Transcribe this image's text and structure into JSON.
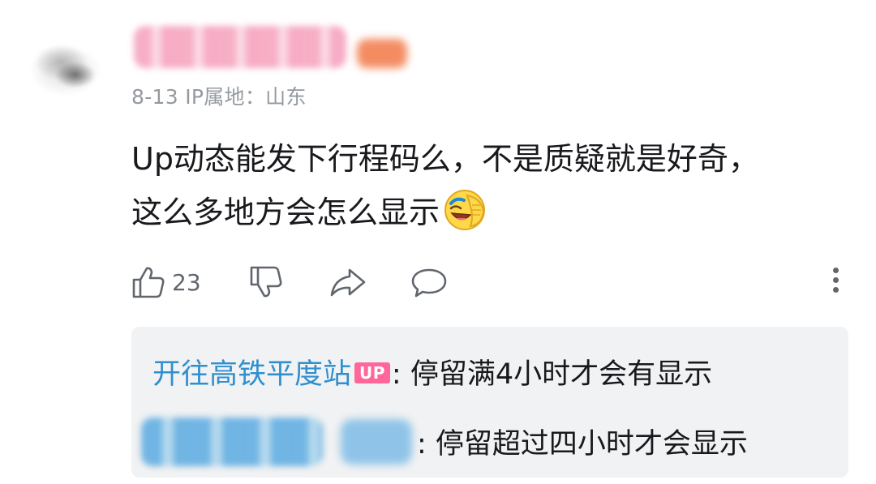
{
  "comment": {
    "date": "8-13",
    "ip_location": "IP属地：山东",
    "text_line1": "Up动态能发下行程码么，不是质疑就是好奇，",
    "text_line2": "这么多地方会怎么显示",
    "emoji_name": "laughing-covering-face-emoji"
  },
  "actions": {
    "like_count": "23",
    "icons": [
      "thumbs-up-icon",
      "thumbs-down-icon",
      "share-icon",
      "reply-bubble-icon",
      "more-vertical-icon"
    ]
  },
  "replies": [
    {
      "username": "开往高铁平度站",
      "badge": "UP",
      "text": ": 停留满4小时才会有显示"
    },
    {
      "text": ": 停留超过四小时才会显示"
    }
  ],
  "colors": {
    "username_link": "#2f8fcf",
    "up_badge_bg": "#ff6699",
    "meta_text": "#9499a0",
    "reply_box_bg": "#f1f2f3"
  }
}
